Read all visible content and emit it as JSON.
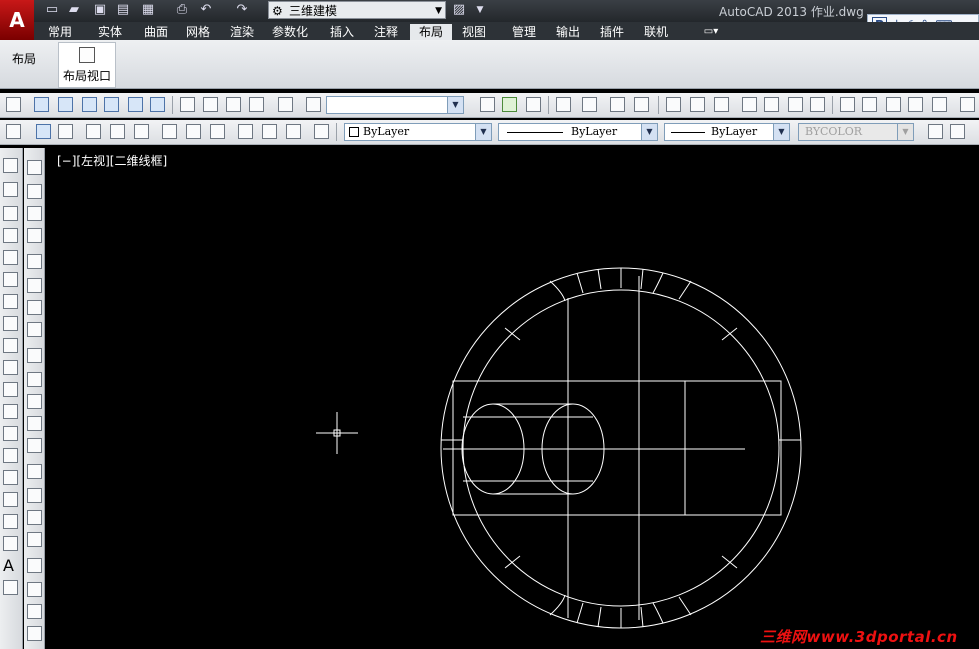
{
  "app": {
    "logo": "A",
    "title": "AutoCAD 2013    作业.dwg",
    "workspace": "三维建模",
    "ime": {
      "p": "P",
      "lang": "中"
    }
  },
  "quick_access": [
    "new-icon",
    "open-icon",
    "save-icon",
    "saveas-icon",
    "plot-icon",
    "undo-icon",
    "redo-icon"
  ],
  "tabs": [
    {
      "label": "常用"
    },
    {
      "label": "实体"
    },
    {
      "label": "曲面"
    },
    {
      "label": "网格"
    },
    {
      "label": "渲染"
    },
    {
      "label": "参数化"
    },
    {
      "label": "插入"
    },
    {
      "label": "注释"
    },
    {
      "label": "布局",
      "active": true
    },
    {
      "label": "视图"
    },
    {
      "label": "管理"
    },
    {
      "label": "输出"
    },
    {
      "label": "插件"
    },
    {
      "label": "联机"
    }
  ],
  "ribbon": {
    "panel_label": "布局",
    "viewport_button": "布局视口"
  },
  "toolbar2": {
    "layer_dropdown": "",
    "color": "ByLayer",
    "linetype": "ByLayer",
    "lineweight": "ByLayer",
    "plotstyle": "BYCOLOR"
  },
  "canvas": {
    "view_label": "[−][左视][二维线框]"
  },
  "watermark": "三维网www.3dportal.cn",
  "colors": {
    "canvas_bg": "#000000",
    "ribbon_accent": "#c81818",
    "drawing_lines": "#ffffff"
  }
}
